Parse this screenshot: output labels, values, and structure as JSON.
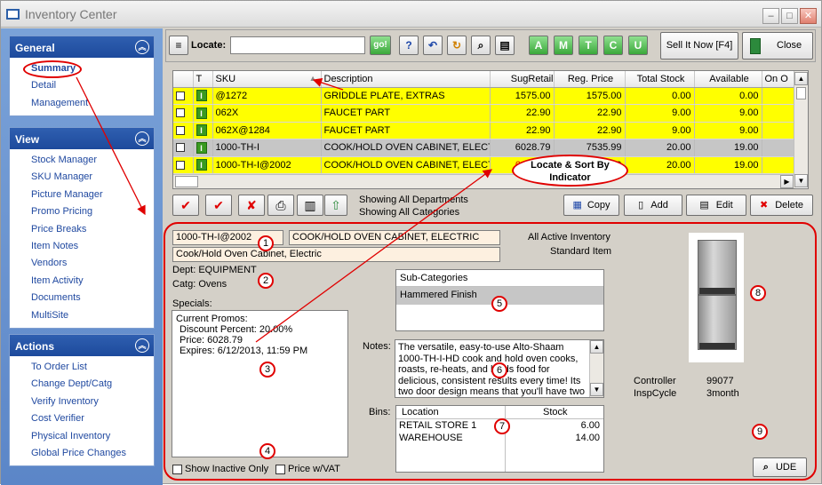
{
  "window": {
    "title": "Inventory Center"
  },
  "left_panel": {
    "general": {
      "title": "General",
      "items": [
        "Summary",
        "Detail",
        "Management"
      ]
    },
    "view": {
      "title": "View",
      "items": [
        "Stock Manager",
        "SKU Manager",
        "Picture Manager",
        "Promo Pricing",
        "Price Breaks",
        "Item Notes",
        "Vendors",
        "Item Activity",
        "Documents",
        "MultiSite"
      ]
    },
    "actions": {
      "title": "Actions",
      "items": [
        "To Order List",
        "Change Dept/Catg",
        "Verify Inventory",
        "Cost Verifier",
        "Physical Inventory",
        "Global Price Changes"
      ]
    }
  },
  "toolbar": {
    "locate_label": "Locate:",
    "locate_value": "",
    "go_label": "go!",
    "filter_buttons": [
      "A",
      "M",
      "T",
      "C",
      "U"
    ],
    "sell_it_now_label": "Sell It Now [F4]",
    "close_label": "Close"
  },
  "grid": {
    "columns": [
      "T",
      "SKU",
      "Description",
      "SugRetail",
      "Reg. Price",
      "Total Stock",
      "Available",
      "On O"
    ],
    "rows": [
      {
        "sku": "@1272",
        "description": "GRIDDLE PLATE, EXTRAS",
        "sug_retail": "1575.00",
        "reg_price": "1575.00",
        "total_stock": "0.00",
        "available": "0.00",
        "style": "yellow"
      },
      {
        "sku": "062X",
        "description": "FAUCET PART",
        "sug_retail": "22.90",
        "reg_price": "22.90",
        "total_stock": "9.00",
        "available": "9.00",
        "style": "yellow"
      },
      {
        "sku": "062X@1284",
        "description": "FAUCET PART",
        "sug_retail": "22.90",
        "reg_price": "22.90",
        "total_stock": "9.00",
        "available": "9.00",
        "style": "yellow"
      },
      {
        "sku": "1000-TH-I",
        "description": "COOK/HOLD OVEN CABINET, ELECTI",
        "sug_retail": "6028.79",
        "reg_price": "7535.99",
        "total_stock": "20.00",
        "available": "19.00",
        "style": "gray"
      },
      {
        "sku": "1000-TH-I@2002",
        "description": "COOK/HOLD OVEN CABINET, ELECTI",
        "sug_retail": "6028.79",
        "reg_price": "7535.99",
        "total_stock": "20.00",
        "available": "19.00",
        "style": "yellow",
        "sug_retail_color": "#e00000"
      }
    ],
    "callout": "Locate & Sort By Indicator"
  },
  "action_bar": {
    "showing_departments": "Showing All Departments",
    "showing_categories": "Showing All Categories",
    "copy_label": "Copy",
    "add_label": "Add",
    "edit_label": "Edit",
    "delete_label": "Delete"
  },
  "detail": {
    "sku": "1000-TH-I@2002",
    "description": "COOK/HOLD OVEN CABINET, ELECTRIC",
    "long_description": "Cook/Hold Oven Cabinet, Electric",
    "inventory_status": "All Active Inventory",
    "item_type": "Standard Item",
    "dept": "Dept: EQUIPMENT",
    "catg": "Catg: Ovens",
    "specials_label": "Specials:",
    "specials_lines": [
      "Current Promos:",
      "Discount Percent: 20.00%",
      "Price:      6028.79",
      "Expires: 6/12/2013, 11:59 PM"
    ],
    "subcategories_header": "Sub-Categories",
    "subcategory": "Hammered Finish",
    "notes_label": "Notes:",
    "notes": "The versatile, easy-to-use Alto-Shaam 1000-TH-I-HD cook and hold oven cooks, roasts, re-heats, and holds food for delicious, consistent results every time! Its two door design means that you'll have two individually",
    "bins_label": "Bins:",
    "bins_headers": [
      "Location",
      "Stock"
    ],
    "bins": [
      {
        "location": "RETAIL STORE 1",
        "stock": "6.00"
      },
      {
        "location": "WAREHOUSE",
        "stock": "14.00"
      }
    ],
    "controller_label": "Controller",
    "controller_value": "99077",
    "inspcycle_label": "InspCycle",
    "inspcycle_value": "3month",
    "show_inactive_label": "Show Inactive Only",
    "price_vat_label": "Price w/VAT",
    "ude_label": "UDE",
    "markers": [
      "1",
      "2",
      "3",
      "4",
      "5",
      "6",
      "7",
      "8",
      "9"
    ]
  },
  "colors": {
    "row_highlight": "#ffff00",
    "row_selected": "#c6c6c6",
    "annotation_red": "#e00000",
    "panel_header": "#1d4a9c"
  }
}
